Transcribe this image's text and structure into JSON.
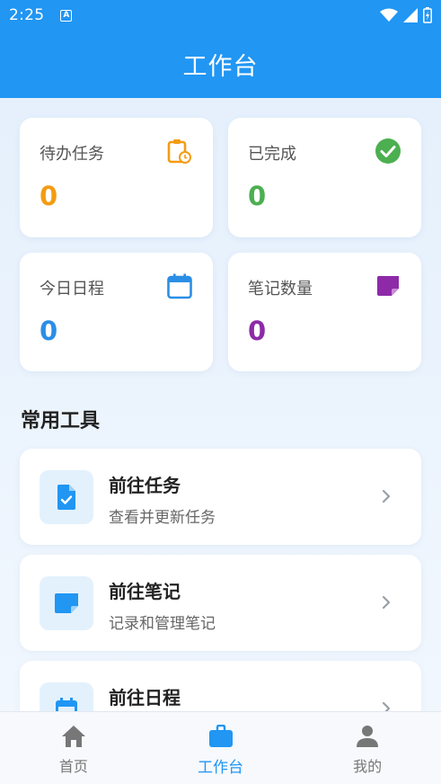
{
  "status": {
    "time": "2:25",
    "sim_label": "A"
  },
  "app": {
    "title": "工作台"
  },
  "stats": [
    {
      "label": "待办任务",
      "value": "0",
      "color": "#f39c12",
      "icon": "clipboard-clock-icon"
    },
    {
      "label": "已完成",
      "value": "0",
      "color": "#4caf50",
      "icon": "check-circle-icon"
    },
    {
      "label": "今日日程",
      "value": "0",
      "color": "#2b8ee6",
      "icon": "calendar-icon"
    },
    {
      "label": "笔记数量",
      "value": "0",
      "color": "#8e2aa8",
      "icon": "note-icon"
    }
  ],
  "tools_section": {
    "title": "常用工具"
  },
  "tools": [
    {
      "name": "前往任务",
      "desc": "查看并更新任务",
      "icon": "task-doc-icon"
    },
    {
      "name": "前往笔记",
      "desc": "记录和管理笔记",
      "icon": "note-icon"
    },
    {
      "name": "前往日程",
      "desc": "",
      "icon": "calendar-icon"
    }
  ],
  "nav": [
    {
      "label": "首页",
      "icon": "home-icon",
      "active": false
    },
    {
      "label": "工作台",
      "icon": "briefcase-icon",
      "active": true
    },
    {
      "label": "我的",
      "icon": "person-icon",
      "active": false
    }
  ],
  "colors": {
    "primary": "#2196f3",
    "nav_inactive": "#777777"
  }
}
